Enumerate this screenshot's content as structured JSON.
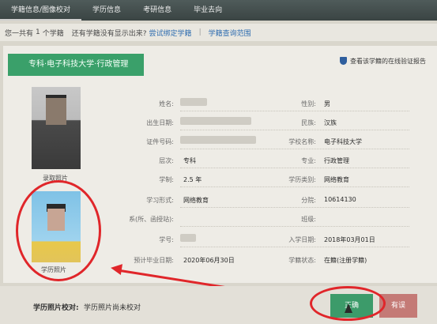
{
  "topnav": {
    "tabs": [
      "学籍信息/图像校对",
      "学历信息",
      "考研信息",
      "毕业去向"
    ]
  },
  "infoline": {
    "prefix": "您一共有",
    "count": "1",
    "suffix": "个学籍",
    "question": "还有学籍没有显示出来?",
    "bind_link": "尝试绑定学籍",
    "scope_link": "学籍查询范围"
  },
  "panel": {
    "school_banner": "专科·电子科技大学·行政管理",
    "verify_link": "查看该学籍的在线验证报告",
    "photo_admission_caption": "录取照片",
    "photo_degree_caption": "学历照片",
    "fields": [
      {
        "label": "姓名:",
        "value": ""
      },
      {
        "label": "性别:",
        "value": "男"
      },
      {
        "label": "出生日期:",
        "value": ""
      },
      {
        "label": "民族:",
        "value": "汉族"
      },
      {
        "label": "证件号码:",
        "value": ""
      },
      {
        "label": "学校名称:",
        "value": "电子科技大学"
      },
      {
        "label": "层次:",
        "value": "专科"
      },
      {
        "label": "专业:",
        "value": "行政管理"
      },
      {
        "label": "学制:",
        "value": "2.5 年"
      },
      {
        "label": "学历类别:",
        "value": "网络教育"
      },
      {
        "label": "学习形式:",
        "value": "网络教育"
      },
      {
        "label": "分院:",
        "value": "10614130"
      },
      {
        "label": "系(所、函授站):",
        "value": ""
      },
      {
        "label": "班级:",
        "value": ""
      },
      {
        "label": "学号:",
        "value": ""
      },
      {
        "label": "入学日期:",
        "value": "2018年03月01日"
      },
      {
        "label": "预计毕业日期:",
        "value": "2020年06月30日"
      },
      {
        "label": "学籍状态:",
        "value": "在籍(注册学籍)"
      }
    ]
  },
  "bottom": {
    "check_label": "学历照片校对:",
    "check_value": "学历照片尚未校对",
    "ok_button": "正确",
    "error_button": "有误"
  },
  "colors": {
    "banner_green": "#3aa06a",
    "ok_button": "#3c9b6a",
    "error_button": "#c47a76",
    "annotation_red": "#e0262a",
    "link_blue": "#2f6db0"
  }
}
